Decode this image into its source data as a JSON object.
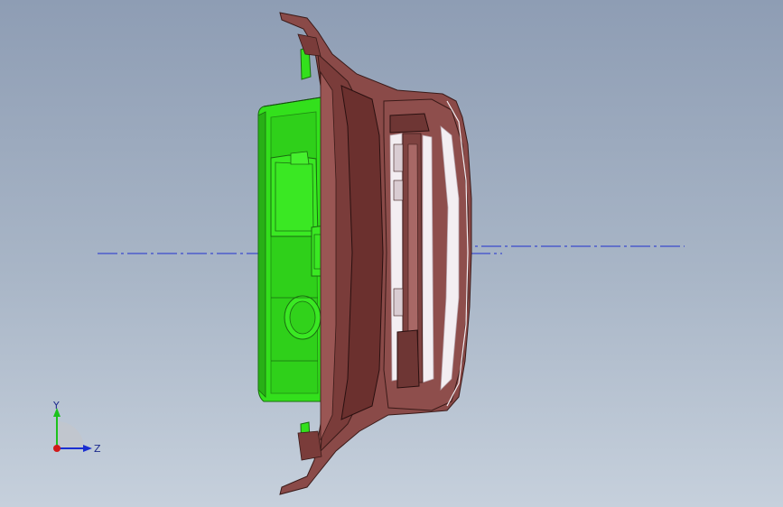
{
  "viewport": {
    "background_top": "#8e9db4",
    "background_bottom": "#c6d0dc"
  },
  "colors": {
    "green_part": "#33e01c",
    "green_edge": "#1a6b10",
    "brown_part": "#8a4a48",
    "brown_edge": "#3a1a18",
    "centerline": "#1f2fd0",
    "highlight": "#f3eef2"
  },
  "triad": {
    "y_label": "Y",
    "z_label": "Z",
    "x_axis_color": "#d11a1a",
    "y_axis_color": "#1cc21c",
    "z_axis_color": "#1a2ed1"
  }
}
